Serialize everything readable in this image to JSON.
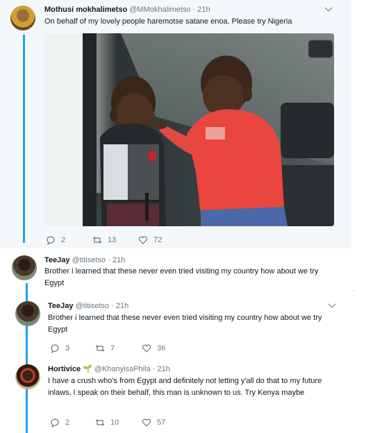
{
  "tweet": {
    "author_name": "Mothusi mokhalimetso",
    "handle": "@MMokhalimetso",
    "time": "21h",
    "text": "On behalf of my lovely people haremotse satane enoa. Please try Nigeria",
    "replies": "2",
    "retweets": "13",
    "likes": "72"
  },
  "quoted_reply": {
    "author_name": "TeeJay",
    "handle": "@titisetso",
    "time": "21h",
    "text": "Brother i learned that these never even tried visiting my country how about we try Egypt"
  },
  "replies": [
    {
      "author_name": "TeeJay",
      "handle": "@titisetso",
      "time": "21h",
      "text": "Brother i learned that these never even tried visiting my country how about we try Egypt",
      "replies": "3",
      "retweets": "7",
      "likes": "36"
    },
    {
      "author_name": "Hortivice",
      "handle": "@KhanyisaPhila",
      "time": "21h",
      "text": "I have a crush who's from Egypt and definitely not letting y'all do that to my future inlaws, I speak on their behalf, this man is unknown to us. Try Kenya maybe",
      "replies": "2",
      "retweets": "10",
      "likes": "57"
    }
  ],
  "icons": {
    "reply": "reply-icon",
    "retweet": "retweet-icon",
    "like": "heart-icon",
    "more": "chevron-down-icon",
    "emoji": "seedling-icon"
  },
  "colors": {
    "accent": "#1da1f2",
    "panel_bg": "#f5f8fa",
    "muted_text": "#657786"
  }
}
